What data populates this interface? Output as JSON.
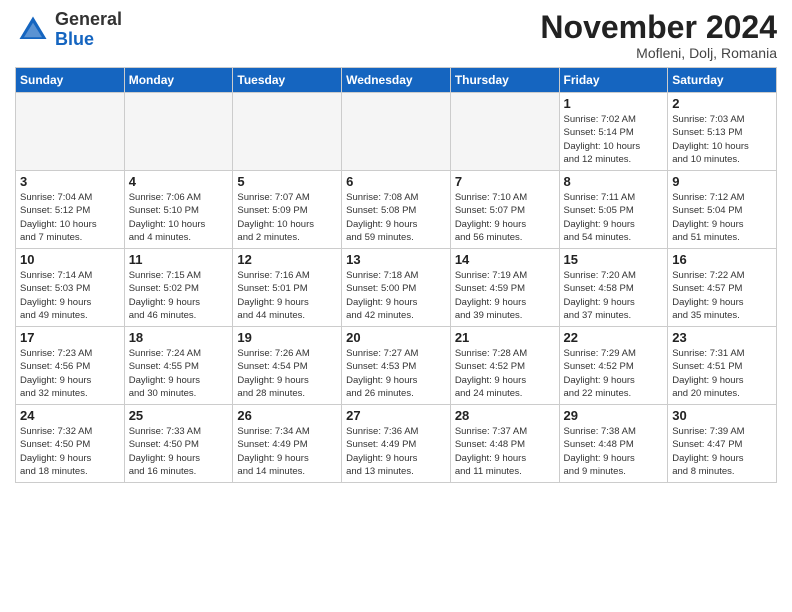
{
  "header": {
    "logo_line1": "General",
    "logo_line2": "Blue",
    "month_title": "November 2024",
    "subtitle": "Mofleni, Dolj, Romania"
  },
  "weekdays": [
    "Sunday",
    "Monday",
    "Tuesday",
    "Wednesday",
    "Thursday",
    "Friday",
    "Saturday"
  ],
  "weeks": [
    [
      {
        "day": "",
        "info": "",
        "empty": true
      },
      {
        "day": "",
        "info": "",
        "empty": true
      },
      {
        "day": "",
        "info": "",
        "empty": true
      },
      {
        "day": "",
        "info": "",
        "empty": true
      },
      {
        "day": "",
        "info": "",
        "empty": true
      },
      {
        "day": "1",
        "info": "Sunrise: 7:02 AM\nSunset: 5:14 PM\nDaylight: 10 hours\nand 12 minutes."
      },
      {
        "day": "2",
        "info": "Sunrise: 7:03 AM\nSunset: 5:13 PM\nDaylight: 10 hours\nand 10 minutes."
      }
    ],
    [
      {
        "day": "3",
        "info": "Sunrise: 7:04 AM\nSunset: 5:12 PM\nDaylight: 10 hours\nand 7 minutes."
      },
      {
        "day": "4",
        "info": "Sunrise: 7:06 AM\nSunset: 5:10 PM\nDaylight: 10 hours\nand 4 minutes."
      },
      {
        "day": "5",
        "info": "Sunrise: 7:07 AM\nSunset: 5:09 PM\nDaylight: 10 hours\nand 2 minutes."
      },
      {
        "day": "6",
        "info": "Sunrise: 7:08 AM\nSunset: 5:08 PM\nDaylight: 9 hours\nand 59 minutes."
      },
      {
        "day": "7",
        "info": "Sunrise: 7:10 AM\nSunset: 5:07 PM\nDaylight: 9 hours\nand 56 minutes."
      },
      {
        "day": "8",
        "info": "Sunrise: 7:11 AM\nSunset: 5:05 PM\nDaylight: 9 hours\nand 54 minutes."
      },
      {
        "day": "9",
        "info": "Sunrise: 7:12 AM\nSunset: 5:04 PM\nDaylight: 9 hours\nand 51 minutes."
      }
    ],
    [
      {
        "day": "10",
        "info": "Sunrise: 7:14 AM\nSunset: 5:03 PM\nDaylight: 9 hours\nand 49 minutes."
      },
      {
        "day": "11",
        "info": "Sunrise: 7:15 AM\nSunset: 5:02 PM\nDaylight: 9 hours\nand 46 minutes."
      },
      {
        "day": "12",
        "info": "Sunrise: 7:16 AM\nSunset: 5:01 PM\nDaylight: 9 hours\nand 44 minutes."
      },
      {
        "day": "13",
        "info": "Sunrise: 7:18 AM\nSunset: 5:00 PM\nDaylight: 9 hours\nand 42 minutes."
      },
      {
        "day": "14",
        "info": "Sunrise: 7:19 AM\nSunset: 4:59 PM\nDaylight: 9 hours\nand 39 minutes."
      },
      {
        "day": "15",
        "info": "Sunrise: 7:20 AM\nSunset: 4:58 PM\nDaylight: 9 hours\nand 37 minutes."
      },
      {
        "day": "16",
        "info": "Sunrise: 7:22 AM\nSunset: 4:57 PM\nDaylight: 9 hours\nand 35 minutes."
      }
    ],
    [
      {
        "day": "17",
        "info": "Sunrise: 7:23 AM\nSunset: 4:56 PM\nDaylight: 9 hours\nand 32 minutes."
      },
      {
        "day": "18",
        "info": "Sunrise: 7:24 AM\nSunset: 4:55 PM\nDaylight: 9 hours\nand 30 minutes."
      },
      {
        "day": "19",
        "info": "Sunrise: 7:26 AM\nSunset: 4:54 PM\nDaylight: 9 hours\nand 28 minutes."
      },
      {
        "day": "20",
        "info": "Sunrise: 7:27 AM\nSunset: 4:53 PM\nDaylight: 9 hours\nand 26 minutes."
      },
      {
        "day": "21",
        "info": "Sunrise: 7:28 AM\nSunset: 4:52 PM\nDaylight: 9 hours\nand 24 minutes."
      },
      {
        "day": "22",
        "info": "Sunrise: 7:29 AM\nSunset: 4:52 PM\nDaylight: 9 hours\nand 22 minutes."
      },
      {
        "day": "23",
        "info": "Sunrise: 7:31 AM\nSunset: 4:51 PM\nDaylight: 9 hours\nand 20 minutes."
      }
    ],
    [
      {
        "day": "24",
        "info": "Sunrise: 7:32 AM\nSunset: 4:50 PM\nDaylight: 9 hours\nand 18 minutes."
      },
      {
        "day": "25",
        "info": "Sunrise: 7:33 AM\nSunset: 4:50 PM\nDaylight: 9 hours\nand 16 minutes."
      },
      {
        "day": "26",
        "info": "Sunrise: 7:34 AM\nSunset: 4:49 PM\nDaylight: 9 hours\nand 14 minutes."
      },
      {
        "day": "27",
        "info": "Sunrise: 7:36 AM\nSunset: 4:49 PM\nDaylight: 9 hours\nand 13 minutes."
      },
      {
        "day": "28",
        "info": "Sunrise: 7:37 AM\nSunset: 4:48 PM\nDaylight: 9 hours\nand 11 minutes."
      },
      {
        "day": "29",
        "info": "Sunrise: 7:38 AM\nSunset: 4:48 PM\nDaylight: 9 hours\nand 9 minutes."
      },
      {
        "day": "30",
        "info": "Sunrise: 7:39 AM\nSunset: 4:47 PM\nDaylight: 9 hours\nand 8 minutes."
      }
    ]
  ]
}
